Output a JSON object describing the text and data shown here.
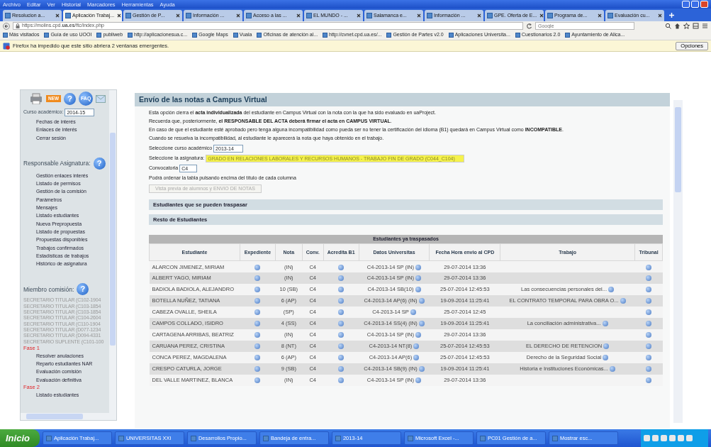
{
  "menu_bar": [
    "Archivo",
    "Editar",
    "Ver",
    "Historial",
    "Marcadores",
    "Herramientas",
    "Ayuda"
  ],
  "tabs": [
    {
      "label": "Resolucion a...",
      "selected": false
    },
    {
      "label": "Aplicación Trabaj...",
      "selected": true
    },
    {
      "label": "Gestión de P...",
      "selected": false
    },
    {
      "label": "Información ...",
      "selected": false
    },
    {
      "label": "Acceso a las ...",
      "selected": false
    },
    {
      "label": "EL MUNDO - ...",
      "selected": false
    },
    {
      "label": "Salamanca e...",
      "selected": false
    },
    {
      "label": "Información ...",
      "selected": false
    },
    {
      "label": "GPE. Oferta de E...",
      "selected": false
    },
    {
      "label": "Programa de...",
      "selected": false
    },
    {
      "label": "Evaluación cu...",
      "selected": false
    }
  ],
  "address_bar": {
    "url": "https://molins.cpd.**ua.es**/ftc/index.php"
  },
  "search": {
    "placeholder": "Google"
  },
  "bookmarks": [
    "Más visitados",
    "Guía de uso UOOI",
    "publiweb",
    "http://aplicacionesua.c...",
    "Google Maps",
    "Vuala",
    "Oficinas de atención al...",
    "http://cvnet.cpd.ua.es/...",
    "Gestión de Partes v2.0",
    "Aplicaciones Universita...",
    "Cuestionarios 2.0",
    "Ayuntamiento de Alica..."
  ],
  "notification": {
    "text": "Firefox ha impedido que este sitio abriera 2 ventanas emergentes.",
    "button": "Opciones"
  },
  "sidebar": {
    "toolbar": {
      "new": "NEW",
      "help": "?",
      "faq": "FAQ"
    },
    "year_label": "Curso académico:",
    "year_value": "2014-15",
    "blocks": [
      {
        "kind": "links",
        "items": [
          "Fechas de interés",
          "Enlaces de interés",
          "Cerrar sesión"
        ]
      },
      {
        "kind": "heading",
        "text": "Responsable Asignatura:",
        "help": "?"
      },
      {
        "kind": "links",
        "items": [
          "Gestión enlaces interés",
          "Listado de permisos",
          "Gestión de la comisión",
          "Parámetros",
          "Mensajes",
          "Listado estudiantes",
          "Nueva Prepropuesta",
          "Listado de propuestas",
          "Propuestas disponibles",
          "Trabajos confirmados",
          "Estadísticas de trabajos",
          "Histórico de asignatura"
        ]
      },
      {
        "kind": "heading",
        "text": "Miembro comisión:",
        "help": "?"
      },
      {
        "kind": "roles",
        "items": [
          "SECRETARIO TITULAR (C102-1904",
          "SECRETARIO TITULAR (C103-1854",
          "SECRETARIO TITULAR (C103-1854",
          "SECRETARIO TITULAR (C104-2604",
          "SECRETARIO TITULAR (C110-1904",
          "SECRETARIO TITULAR (D077-1234",
          "SECRETARIO TITULAR (D094-4331",
          "SECRETARIO SUPLENTE (C101-100"
        ]
      },
      {
        "kind": "phase",
        "text": "Fase 1"
      },
      {
        "kind": "links",
        "items": [
          "Resolver anulaciones",
          "Reparto estudiantes NAR",
          "Evaluación comisión",
          "Evaluación definitiva"
        ]
      },
      {
        "kind": "phase",
        "text": "Fase 2"
      },
      {
        "kind": "links",
        "items": [
          "Listado estudiantes"
        ]
      }
    ]
  },
  "main": {
    "title": "Envío de las notas a Campus Virtual",
    "paragraphs": [
      "Esta opción cierra el **acta individualizada** del estudiante en Campus Virtual con la nota con la que ha sido evaluado en uaProject.",
      "Recuerda que, posteriormente, **el RESPONSABLE DEL ACTA deberá firmar el acta en CAMPUS VIRTUAL**.",
      "En caso de que el estudiante esté aprobado pero tenga alguna incompatibilidad como pueda ser no tener la certificación del idioma (B1) quedará en Campus Virtual como **INCOMPATIBLE**.",
      "Cuando se resuelva la incompatibilidad, al estudiante le aparecerá la nota que haya obtenido en el trabajo."
    ],
    "fields": [
      {
        "label": "Seleccione curso académico",
        "value": "2013-14",
        "highlighted": false
      },
      {
        "label": "Seleccione la asignatura:",
        "value": "GRADO EN RELACIONES LABORALES Y RECURSOS HUMANOS - TRABAJO FIN DE GRADO (C044_C104)",
        "highlighted": true
      },
      {
        "label": "Convocatoria",
        "value": "C4",
        "highlighted": false
      }
    ],
    "hint": "Podrá ordenar la tabla pulsando encima del título de cada columna",
    "button": {
      "label": "Vista previa de alumnos y ENVIO DE NOTAS",
      "disabled": true
    },
    "sections": [
      "Estudiantes que se pueden traspasar",
      "Resto de Estudiantes"
    ]
  },
  "table": {
    "caption": "Estudiantes ya traspasados",
    "columns": [
      "Estudiante",
      "Expediente",
      "Nota",
      "Conv.",
      "Acredita B1",
      "Datos Universitas",
      "Fecha Hora envio al CPD",
      "Trabajo",
      "Tribunal"
    ],
    "rows": [
      {
        "student": "ALARCON JIMENEZ, MIRIAM",
        "nota": "(IN)",
        "conv": "C4",
        "datos": "C4-2013-14 SP (IN)",
        "fecha": "29-07-2014 13:36"
      },
      {
        "student": "ALBERT YAGO, MIRIAM",
        "nota": "(IN)",
        "conv": "C4",
        "datos": "C4-2013-14 SP (IN)",
        "fecha": "29-07-2014 13:36"
      },
      {
        "student": "BADIOLA BADIOLA, ALEJANDRO",
        "nota": "10 (SB)",
        "conv": "C4",
        "datos": "C4-2013-14 SB(10)",
        "fecha": "25-07-2014 12:45:53",
        "trabajo": "Las consecuencias personales del..."
      },
      {
        "student": "BOTELLA NUÑEZ, TATIANA",
        "nota": "6 (AP)",
        "conv": "C4",
        "datos": "C4-2013-14 AP(6) (IN)",
        "fecha": "19-09-2014 11:25:41",
        "trabajo": "EL CONTRATO TEMPORAL PARA OBRA O..."
      },
      {
        "student": "CABEZA OVALLE, SHEILA",
        "nota": "(SP)",
        "conv": "C4",
        "datos": "C4-2013-14 SP",
        "fecha": "25-07-2014 12:45"
      },
      {
        "student": "CAMPOS COLLADO, ISIDRO",
        "nota": "4 (SS)",
        "conv": "C4",
        "datos": "C4-2013-14 SS(4) (IN)",
        "fecha": "19-09-2014 11:25:41",
        "trabajo": "La conciliación administrativa..."
      },
      {
        "student": "CARTAGENA ARRIBAS, BEATRIZ",
        "nota": "(IN)",
        "conv": "C4",
        "datos": "C4-2013-14 SP (IN)",
        "fecha": "29-07-2014 13:36"
      },
      {
        "student": "CARUANA PEREZ, CRISTINA",
        "nota": "8 (NT)",
        "conv": "C4",
        "datos": "C4-2013-14 NT(8)",
        "fecha": "25-07-2014 12:45:53",
        "trabajo": "EL DERECHO DE RETENCION"
      },
      {
        "student": "CONCA PEREZ, MAGDALENA",
        "nota": "6 (AP)",
        "conv": "C4",
        "datos": "C4-2013-14 AP(6)",
        "fecha": "25-07-2014 12:45:53",
        "trabajo": "Derecho de la Seguridad Social"
      },
      {
        "student": "CRESPO CATURLA, JORGE",
        "nota": "9 (SB)",
        "conv": "C4",
        "datos": "C4-2013-14 SB(9) (IN)",
        "fecha": "19-09-2014 11:25:41",
        "trabajo": "Historia e Instituciones Económicas..."
      },
      {
        "student": "DEL VALLE MARTINEZ, BLANCA",
        "nota": "(IN)",
        "conv": "C4",
        "datos": "C4-2013-14 SP (IN)",
        "fecha": "29-07-2014 13:36"
      }
    ]
  },
  "taskbar": {
    "start": "Inicio",
    "items": [
      "Aplicación Trabaj...",
      "UNIVERSITAS XXI",
      "Desarrollos Propio...",
      "Bandeja de entra...",
      "2013-14",
      "Microsoft Excel -...",
      "PC01 Gestión de a...",
      "Mostrar esc..."
    ]
  }
}
